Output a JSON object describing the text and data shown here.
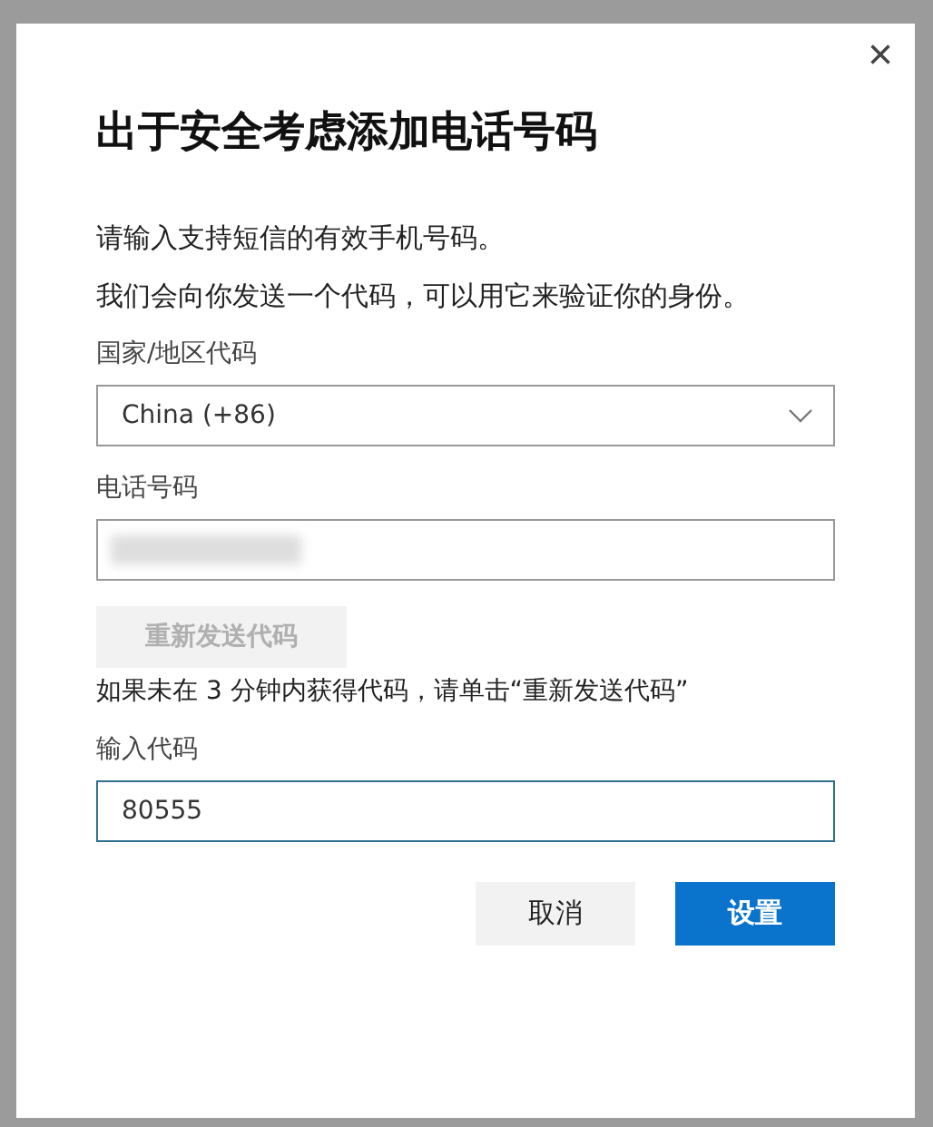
{
  "dialog": {
    "title": "出于安全考虑添加电话号码",
    "close": "×",
    "intro": [
      "请输入支持短信的有效手机号码。",
      "我们会向你发送一个代码，可以用它来验证你的身份。"
    ],
    "country": {
      "label": "国家/地区代码",
      "value": "China (+86)"
    },
    "phone": {
      "label": "电话号码",
      "blurred": true
    },
    "resend": {
      "label": "重新发送代码",
      "disabled": true
    },
    "hint": "如果未在 3 分钟内获得代码，请单击“重新发送代码”",
    "code": {
      "label": "输入代码",
      "value": "80555",
      "focused": true
    },
    "buttons": [
      {
        "label": "取消",
        "kind": "secondary"
      },
      {
        "label": "设置",
        "kind": "primary"
      }
    ]
  }
}
